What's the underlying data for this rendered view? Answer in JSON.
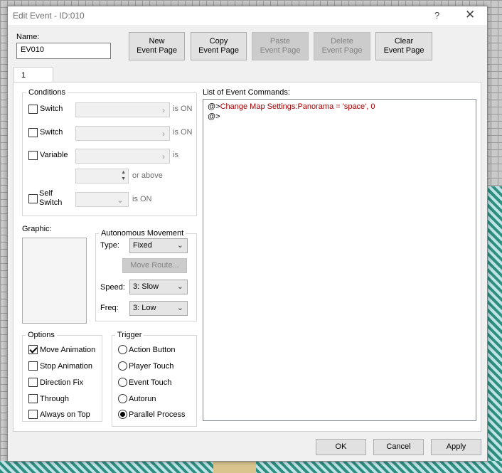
{
  "window": {
    "title": "Edit Event - ID:010",
    "help": "?",
    "close": "✕"
  },
  "name": {
    "label": "Name:",
    "value": "EV010"
  },
  "buttons": {
    "new_page": [
      "New",
      "Event Page"
    ],
    "copy_page": [
      "Copy",
      "Event Page"
    ],
    "paste_page": [
      "Paste",
      "Event Page"
    ],
    "delete_page": [
      "Delete",
      "Event Page"
    ],
    "clear_page": [
      "Clear",
      "Event Page"
    ]
  },
  "tab": {
    "label": "1"
  },
  "conditions": {
    "title": "Conditions",
    "switch1_label": "Switch",
    "switch1_suffix": "is ON",
    "switch2_label": "Switch",
    "switch2_suffix": "is ON",
    "variable_label": "Variable",
    "variable_suffix": "is",
    "or_above": "or above",
    "self_switch_label": [
      "Self",
      "Switch"
    ],
    "self_switch_suffix": "is ON"
  },
  "graphic": {
    "label": "Graphic:"
  },
  "autonomous": {
    "title": "Autonomous Movement",
    "type_label": "Type:",
    "type_value": "Fixed",
    "move_route": "Move Route...",
    "speed_label": "Speed:",
    "speed_value": "3: Slow",
    "freq_label": "Freq:",
    "freq_value": "3: Low"
  },
  "options": {
    "title": "Options",
    "items": [
      {
        "label": "Move Animation",
        "checked": true
      },
      {
        "label": "Stop Animation",
        "checked": false
      },
      {
        "label": "Direction Fix",
        "checked": false
      },
      {
        "label": "Through",
        "checked": false
      },
      {
        "label": "Always on Top",
        "checked": false
      }
    ]
  },
  "trigger": {
    "title": "Trigger",
    "items": [
      {
        "label": "Action Button",
        "selected": false
      },
      {
        "label": "Player Touch",
        "selected": false
      },
      {
        "label": "Event Touch",
        "selected": false
      },
      {
        "label": "Autorun",
        "selected": false
      },
      {
        "label": "Parallel Process",
        "selected": true
      }
    ]
  },
  "commands": {
    "title": "List of Event Commands:",
    "lines": [
      {
        "prefix": "@>",
        "text": "Change Map Settings:Panorama = 'space', 0"
      },
      {
        "prefix": "@>",
        "text": ""
      }
    ]
  },
  "footer": {
    "ok": "OK",
    "cancel": "Cancel",
    "apply": "Apply"
  }
}
